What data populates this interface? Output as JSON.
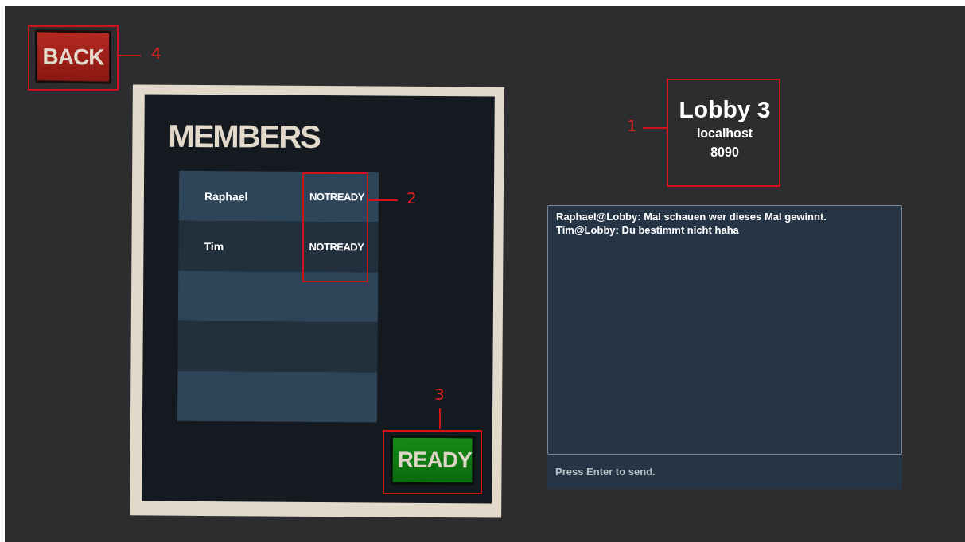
{
  "back_button": {
    "label": "BACK"
  },
  "members": {
    "title": "MEMBERS",
    "rows": [
      {
        "kind": "member",
        "name": "Raphael",
        "status": "NOTREADY"
      },
      {
        "kind": "member",
        "name": "Tim",
        "status": "NOTREADY"
      },
      {
        "kind": "empty"
      },
      {
        "kind": "empty"
      },
      {
        "kind": "empty"
      }
    ]
  },
  "ready_button": {
    "label": "READY"
  },
  "lobby": {
    "name": "Lobby 3",
    "host": "localhost",
    "port": "8090"
  },
  "chat": {
    "messages": [
      "Raphael@Lobby: Mal schauen wer dieses Mal gewinnt.",
      "Tim@Lobby: Du bestimmt nicht haha"
    ],
    "placeholder": "Press Enter to send."
  },
  "annotations": [
    {
      "kind": "back",
      "number": "4"
    },
    {
      "kind": "status",
      "number": "2"
    },
    {
      "kind": "ready",
      "number": "3"
    },
    {
      "kind": "lobby",
      "number": "1"
    }
  ]
}
